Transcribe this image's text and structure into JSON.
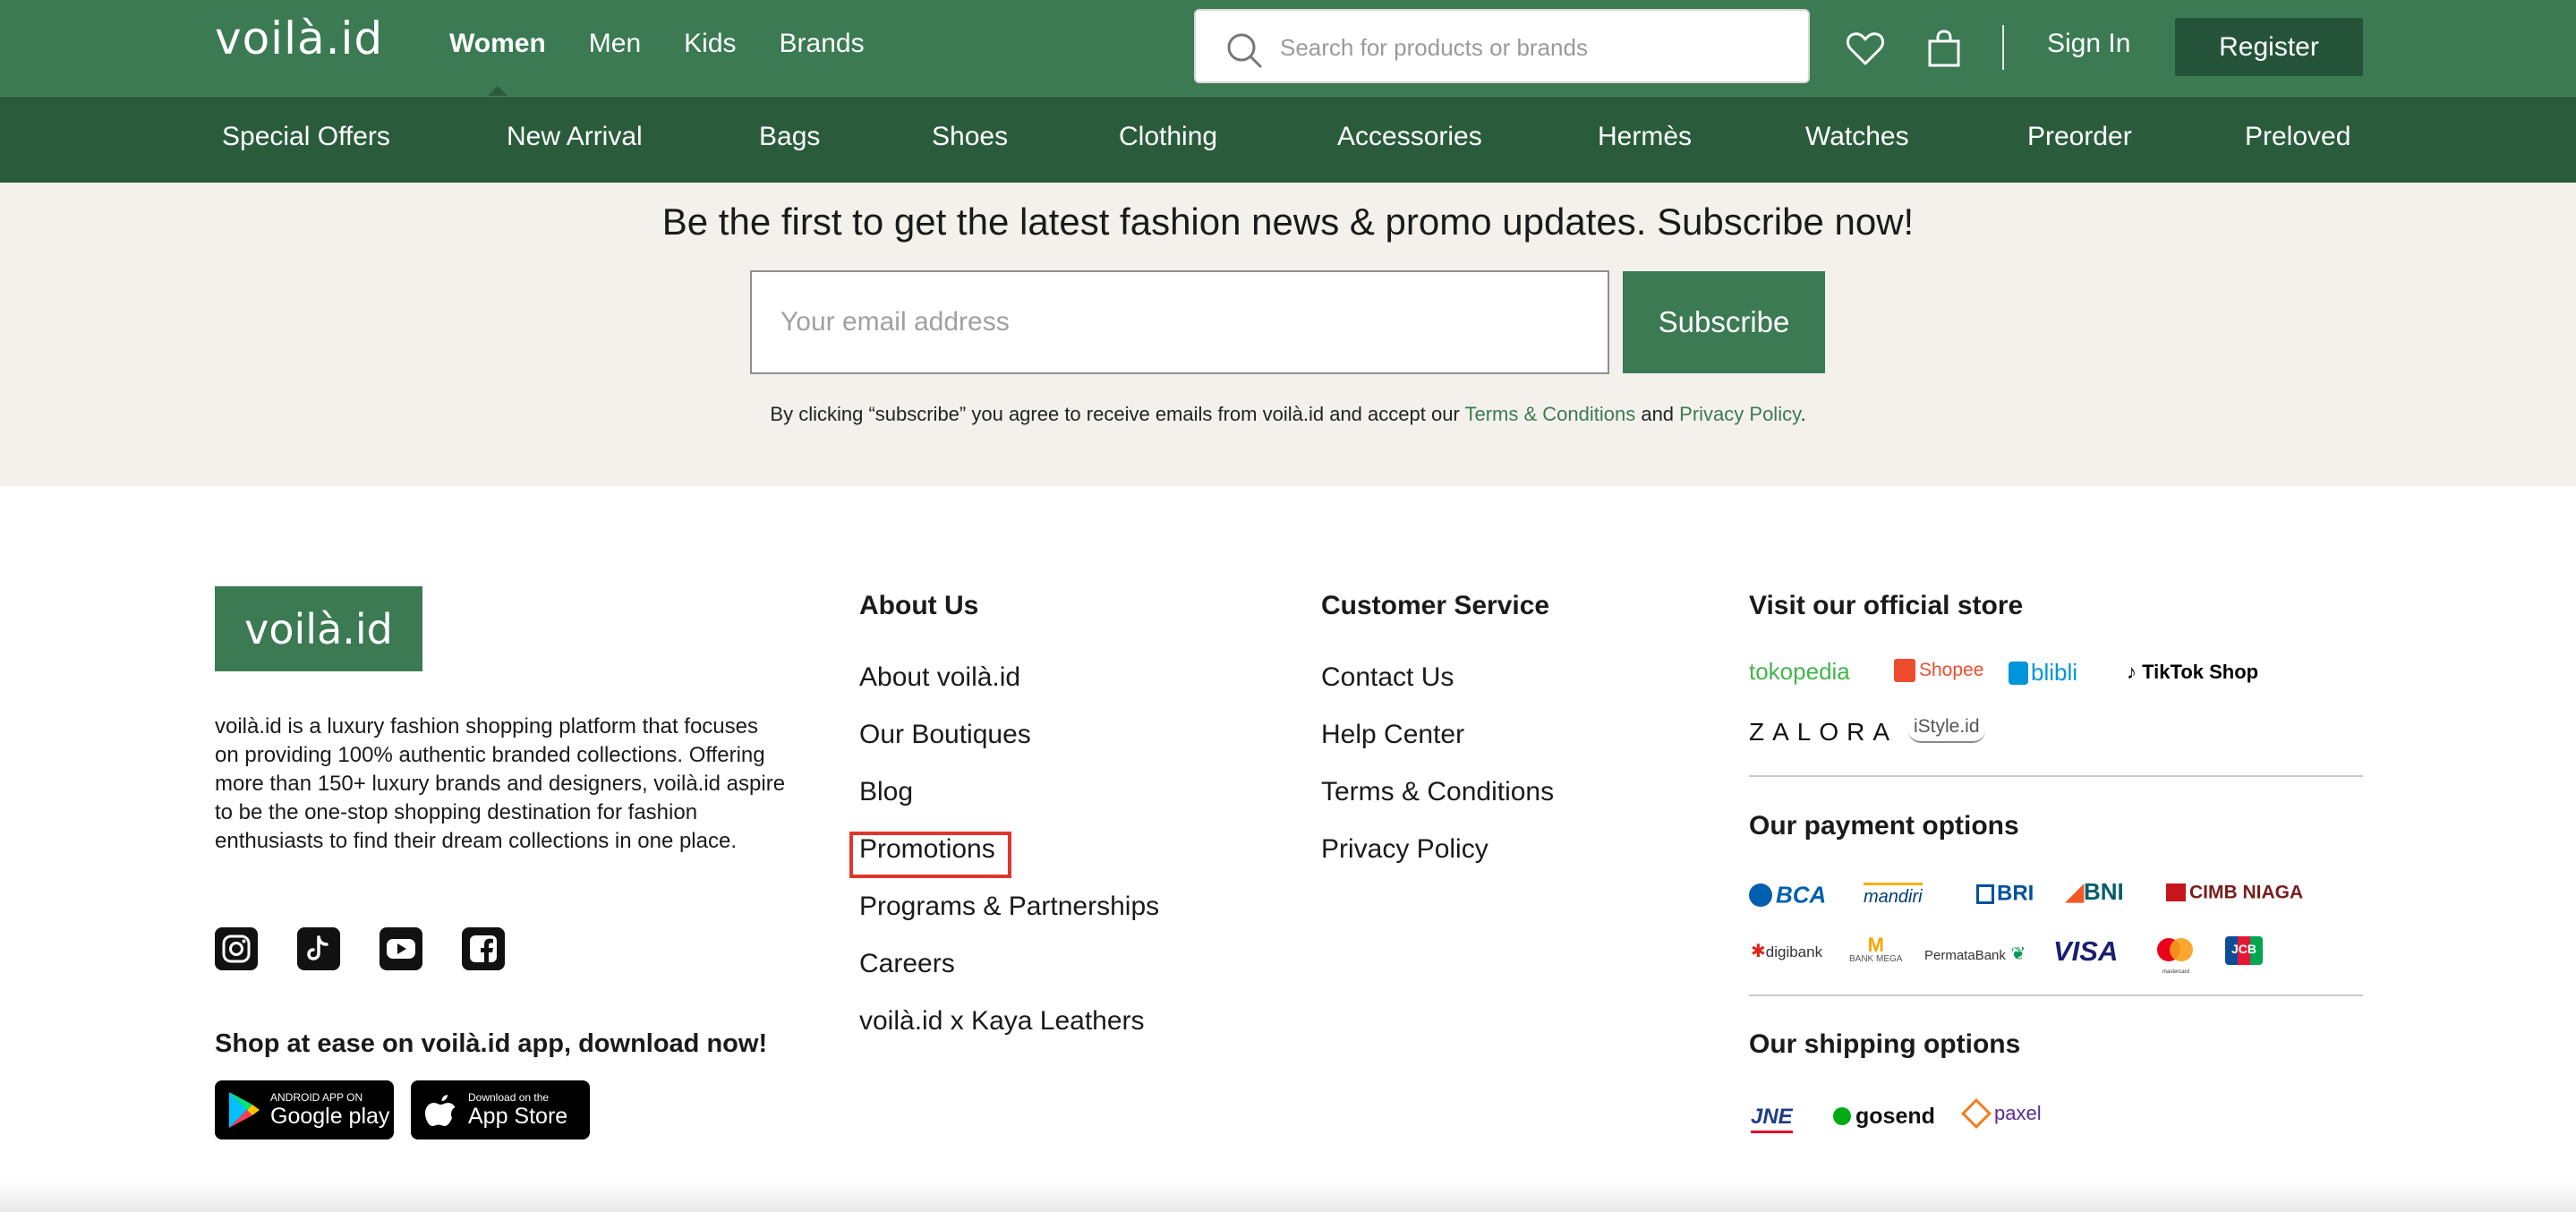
{
  "header": {
    "logo": "voilà.id",
    "nav": [
      "Women",
      "Men",
      "Kids",
      "Brands"
    ],
    "search_placeholder": "Search for products or brands",
    "sign_in": "Sign In",
    "register": "Register"
  },
  "categories": [
    "Special Offers",
    "New Arrival",
    "Bags",
    "Shoes",
    "Clothing",
    "Accessories",
    "Hermès",
    "Watches",
    "Preorder",
    "Preloved"
  ],
  "subscribe": {
    "title": "Be the first to get the latest fashion news & promo updates. Subscribe now!",
    "email_placeholder": "Your email address",
    "button": "Subscribe",
    "note_before": "By clicking “subscribe” you agree to receive emails from voilà.id and accept our ",
    "terms_link": "Terms & Conditions",
    "note_and": " and ",
    "privacy_link": "Privacy Policy",
    "note_end": "."
  },
  "footer": {
    "logo": "voilà.id",
    "description": "voilà.id is a luxury fashion shopping platform that focuses on providing 100% authentic branded collections. Offering more than 150+ luxury brands and designers, voilà.id aspire to be the one-stop shopping destination for fashion enthusiasts to find their dream collections in one place.",
    "social_icons": [
      "instagram-icon",
      "tiktok-icon",
      "youtube-icon",
      "facebook-icon"
    ],
    "app_title": "Shop at ease on voilà.id app, download now!",
    "google_play": {
      "small": "ANDROID APP ON",
      "big": "Google play"
    },
    "app_store": {
      "small": "Download on the",
      "big": "App Store"
    },
    "about": {
      "heading": "About Us",
      "links": [
        "About voilà.id",
        "Our Boutiques",
        "Blog",
        "Promotions",
        "Programs & Partnerships",
        "Careers",
        "voilà.id x Kaya Leathers"
      ]
    },
    "customer_service": {
      "heading": "Customer Service",
      "links": [
        "Contact Us",
        "Help Center",
        "Terms & Conditions",
        "Privacy Policy"
      ]
    },
    "official_store": {
      "heading": "Visit our official store",
      "stores": [
        "tokopedia",
        "Shopee",
        "blibli",
        "TikTok Shop",
        "ZALORA",
        "iStyle.id"
      ]
    },
    "payment": {
      "heading": "Our payment options",
      "methods": [
        "BCA",
        "mandiri",
        "BRI",
        "BNI",
        "CIMB NIAGA",
        "digibank",
        "BANK MEGA",
        "PermataBank",
        "VISA",
        "mastercard",
        "JCB"
      ]
    },
    "shipping": {
      "heading": "Our shipping options",
      "methods": [
        "JNE",
        "gosend",
        "paxel"
      ]
    }
  },
  "colors": {
    "brand_green": "#3b7a52",
    "dark_green": "#2a5c3c",
    "highlight_red": "#e0362c"
  }
}
